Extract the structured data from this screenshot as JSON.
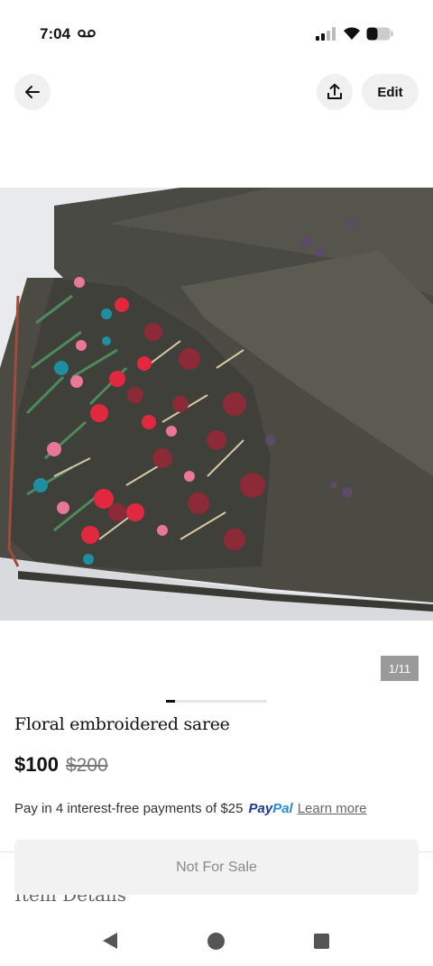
{
  "status_bar": {
    "time": "7:04",
    "icons": [
      "voicemail-icon",
      "signal-icon",
      "wifi-icon",
      "battery-icon"
    ]
  },
  "top_bar": {
    "back_icon": "arrow-left-icon",
    "share_icon": "share-upload-icon",
    "edit_label": "Edit"
  },
  "image": {
    "description_icon": "floral-embroidered-saree-photo",
    "counter": "1/11",
    "pager_position": 1,
    "pager_total": 11
  },
  "product": {
    "title": "Floral embroidered saree",
    "price": "$100",
    "original_price": "$200"
  },
  "paypal": {
    "text": "Pay in 4 interest-free payments of $25",
    "logo_pay": "Pay",
    "logo_pal": "Pal",
    "learn_more": "Learn more"
  },
  "sections": {
    "item_details": "Item Details"
  },
  "cta": {
    "label": "Not For Sale"
  },
  "nav_bar": {
    "icons": [
      "nav-back-icon",
      "nav-home-icon",
      "nav-recents-icon"
    ]
  },
  "colors": {
    "paypal_dark": "#1a3a8f",
    "paypal_light": "#2a8ad8",
    "cta_bg": "#f2f2f2",
    "button_bg": "#f0f0f0"
  }
}
